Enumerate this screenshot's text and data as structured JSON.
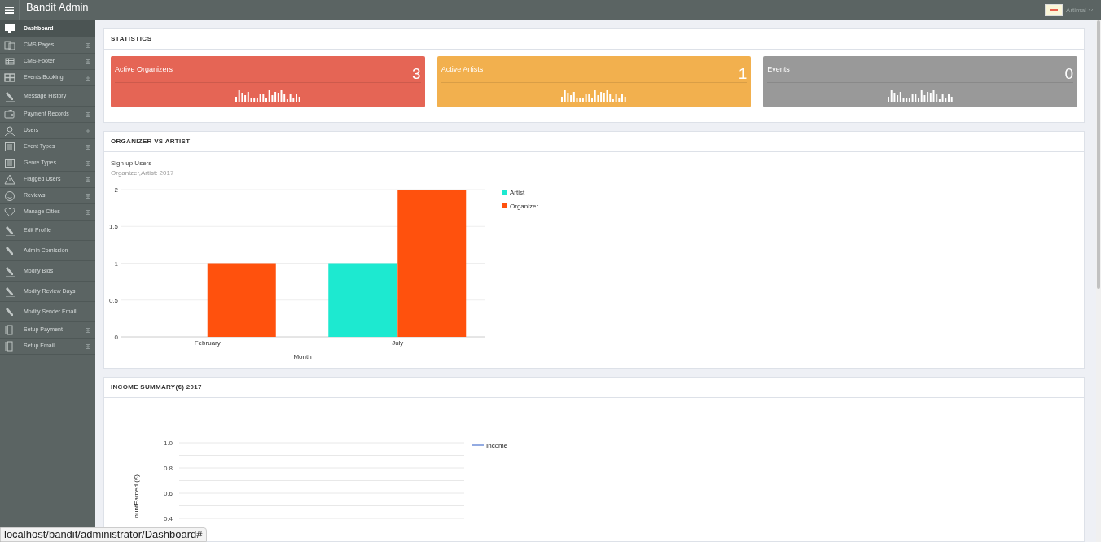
{
  "app": {
    "title": "Bandit Admin",
    "user": "Artimal"
  },
  "sidebar": {
    "items": [
      {
        "label": "Dashboard",
        "kind": "monitor",
        "expandable": false,
        "selected": true
      },
      {
        "label": "CMS Pages",
        "kind": "pages",
        "expandable": true,
        "selected": false
      },
      {
        "label": "CMS-Footer",
        "kind": "grid",
        "expandable": true,
        "selected": false
      },
      {
        "label": "Events Booking",
        "kind": "booking",
        "expandable": true,
        "selected": false
      },
      {
        "label": "Message History",
        "kind": "pencil",
        "expandable": false,
        "selected": false
      },
      {
        "label": "Payment Records",
        "kind": "wallet",
        "expandable": true,
        "selected": false
      },
      {
        "label": "Users",
        "kind": "user",
        "expandable": true,
        "selected": false
      },
      {
        "label": "Event Types",
        "kind": "columns",
        "expandable": true,
        "selected": false
      },
      {
        "label": "Genre Types",
        "kind": "columns",
        "expandable": true,
        "selected": false
      },
      {
        "label": "Flagged Users",
        "kind": "warning",
        "expandable": true,
        "selected": false
      },
      {
        "label": "Reviews",
        "kind": "smiley",
        "expandable": true,
        "selected": false
      },
      {
        "label": "Manage Cities",
        "kind": "heart",
        "expandable": true,
        "selected": false
      },
      {
        "label": "Edit Profile",
        "kind": "pencil",
        "expandable": false,
        "selected": false
      },
      {
        "label": "Admin Comission",
        "kind": "pencil",
        "expandable": false,
        "selected": false
      },
      {
        "label": "Modify Bids",
        "kind": "pencil",
        "expandable": false,
        "selected": false
      },
      {
        "label": "Modify Review Days",
        "kind": "pencil",
        "expandable": false,
        "selected": false
      },
      {
        "label": "Modify Sender Email",
        "kind": "pencil",
        "expandable": false,
        "selected": false
      },
      {
        "label": "Setup Payment",
        "kind": "door",
        "expandable": true,
        "selected": false
      },
      {
        "label": "Setup Email",
        "kind": "door",
        "expandable": true,
        "selected": false
      }
    ]
  },
  "statistics": {
    "title": "STATISTICS",
    "cards": [
      {
        "label": "Active Organizers",
        "value": "3",
        "color": "#e56555"
      },
      {
        "label": "Active Artists",
        "value": "1",
        "color": "#f2b04e"
      },
      {
        "label": "Events",
        "value": "0",
        "color": "#999999"
      }
    ]
  },
  "organizer_vs_artist": {
    "title": "ORGANIZER VS ARTIST",
    "chart_title": "Sign up Users",
    "chart_subtitle": "Organizer,Artist: 2017",
    "chart_data": {
      "type": "bar",
      "xlabel": "Month",
      "grid": true,
      "legend": true,
      "categories": [
        "February",
        "July"
      ],
      "series": [
        {
          "name": "Artist",
          "color": "#1de9d0",
          "values": [
            0,
            1
          ]
        },
        {
          "name": "Organizer",
          "color": "#ff510d",
          "values": [
            1,
            2
          ]
        }
      ],
      "ylim": [
        0,
        2
      ],
      "yticks": [
        {
          "value": 0,
          "label": "0"
        },
        {
          "value": 0.5,
          "label": "0.5"
        },
        {
          "value": 1,
          "label": "1"
        },
        {
          "value": 1.5,
          "label": "1.5"
        },
        {
          "value": 2,
          "label": "2"
        }
      ]
    }
  },
  "income_summary": {
    "title": "INCOME SUMMARY(€) 2017",
    "chart_data": {
      "type": "line",
      "ylabel": "ountEarned (€)",
      "grid": true,
      "legend": true,
      "ylim": [
        0.4,
        1
      ],
      "series": [
        {
          "name": "Income",
          "color": "#6f8fd8",
          "values": [
            null
          ]
        }
      ],
      "yticks": [
        {
          "value": 1,
          "label": "1.0"
        },
        {
          "value": 0.8,
          "label": "0.8"
        },
        {
          "value": 0.6,
          "label": "0.6"
        },
        {
          "value": 0.4,
          "label": "0.4"
        }
      ]
    }
  },
  "status_link": "localhost/bandit/administrator/Dashboard#"
}
